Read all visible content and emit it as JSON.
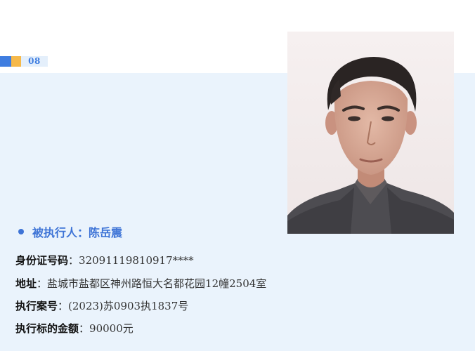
{
  "section_number": "08",
  "subject": {
    "label": "被执行人：",
    "name": "陈岳震"
  },
  "fields": {
    "id": {
      "label": "身份证号码",
      "sep": "：",
      "value": "32091119810917****"
    },
    "address": {
      "label": "地址",
      "sep": "：",
      "value": "盐城市盐都区神州路恒大名都花园12幢2504室"
    },
    "case_no": {
      "label": "执行案号",
      "sep": "：",
      "value": "(2023)苏0903执1837号"
    },
    "amount": {
      "label": "执行标的金额",
      "sep": "：",
      "value": "90000元"
    }
  },
  "colors": {
    "accent_blue": "#3f7de0",
    "accent_yellow": "#f6b94a",
    "panel_bg": "#eaf3fc",
    "name_blue": "#3d73d6"
  }
}
